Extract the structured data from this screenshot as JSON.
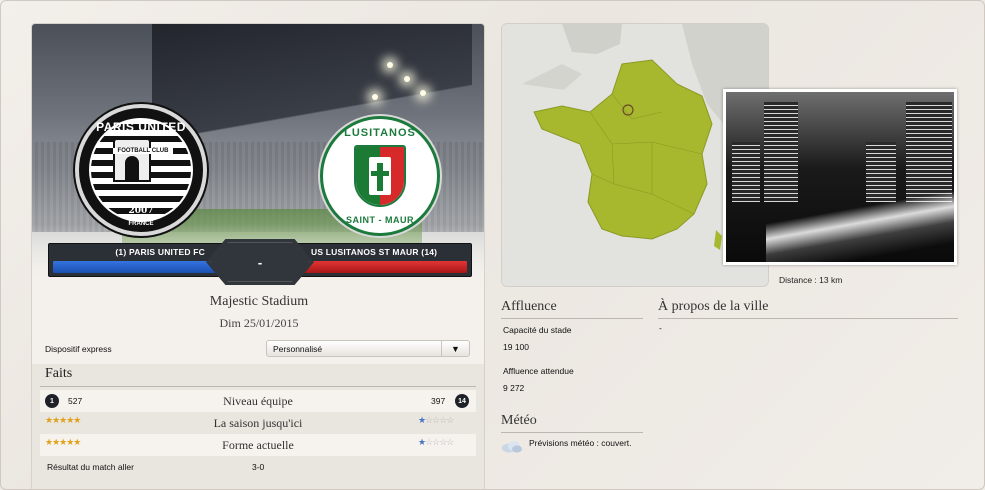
{
  "match": {
    "home_team": "(1) PARIS UNITED FC",
    "away_team": "US LUSITANOS ST MAUR (14)",
    "score": "-",
    "venue": "Majestic Stadium",
    "date": "Dim 25/01/2015"
  },
  "logos": {
    "home": {
      "line1": "PARIS UNITED",
      "line2": "FOOTBALL CLUB",
      "year": "2007",
      "country": "FRANCE"
    },
    "away": {
      "line1": "LUSITANOS",
      "line2": "SAINT - MAUR"
    }
  },
  "dispositif": {
    "label": "Dispositif express",
    "selected": "Personnalisé"
  },
  "faits": {
    "title": "Faits",
    "niveau": {
      "home_rank": "1",
      "home_value": "527",
      "label": "Niveau équipe",
      "away_value": "397",
      "away_rank": "14"
    },
    "saison": {
      "label": "La saison jusqu'ici",
      "home_stars": 5,
      "away_stars": 1
    },
    "forme": {
      "label": "Forme actuelle",
      "home_stars": 5,
      "away_stars": 1
    },
    "aller": {
      "label": "Résultat du match aller",
      "value": "3-0"
    }
  },
  "city": {
    "distance": "Distance : 13 km"
  },
  "affluence": {
    "title": "Affluence",
    "capacity_label": "Capacité du stade",
    "capacity_value": "19 100",
    "expected_label": "Affluence attendue",
    "expected_value": "9 272"
  },
  "meteo": {
    "title": "Météo",
    "forecast": "Prévisions météo : couvert.",
    "icon": "cloud-icon"
  },
  "apropos": {
    "title": "À propos de la ville",
    "text": "-"
  },
  "colors": {
    "home": "#2a63d0",
    "away": "#d62a2a",
    "map_france": "#a8b82e",
    "stars": "#e0a21c"
  }
}
